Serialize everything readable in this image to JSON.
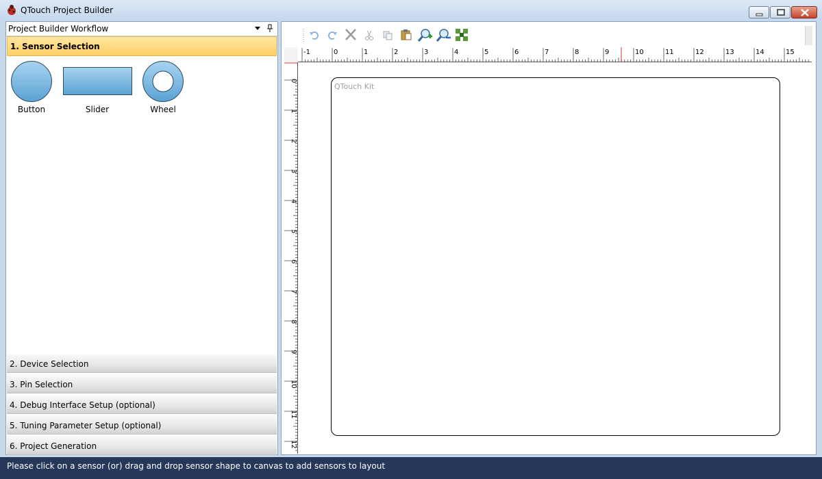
{
  "window": {
    "title": "QTouch Project Builder"
  },
  "panel": {
    "title": "Project Builder Workflow"
  },
  "sections": [
    {
      "label": "1. Sensor Selection",
      "active": true
    },
    {
      "label": "2. Device Selection"
    },
    {
      "label": "3. Pin Selection"
    },
    {
      "label": "4. Debug Interface Setup (optional)"
    },
    {
      "label": "5. Tuning Parameter Setup  (optional)"
    },
    {
      "label": "6. Project Generation"
    }
  ],
  "sensors": [
    {
      "label": "Button",
      "icon": "button-sensor-icon"
    },
    {
      "label": "Slider",
      "icon": "slider-sensor-icon"
    },
    {
      "label": "Wheel",
      "icon": "wheel-sensor-icon"
    }
  ],
  "toolbar": {
    "icons": [
      "undo-icon",
      "redo-icon",
      "delete-icon",
      "cut-icon",
      "copy-icon",
      "paste-icon",
      "zoom-in-icon",
      "zoom-out-icon",
      "fit-to-screen-icon"
    ]
  },
  "ruler": {
    "top_labels": [
      "-1",
      "0",
      "1",
      "2",
      "3",
      "4",
      "5",
      "6",
      "7",
      "8",
      "9",
      "10",
      "11",
      "12",
      "13",
      "14",
      "15"
    ],
    "left_labels": [
      "0",
      "1",
      "2",
      "3",
      "4",
      "5",
      "6",
      "7",
      "8",
      "9",
      "10",
      "11",
      "12"
    ]
  },
  "canvas": {
    "kit_label": "QTouch Kit"
  },
  "status": {
    "text": "Please click on a sensor (or) drag and drop sensor shape to canvas to add sensors to layout"
  },
  "colors": {
    "accent": "#ffd067",
    "statusbar": "#25385a",
    "sensor_fill": "#7ab7de"
  }
}
